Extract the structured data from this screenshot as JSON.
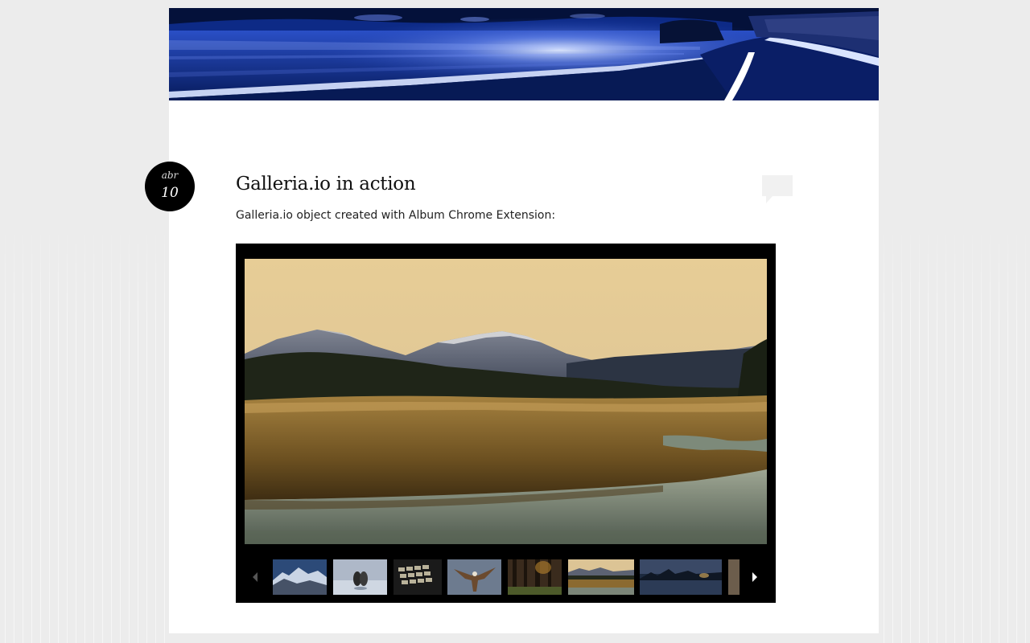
{
  "post": {
    "date": {
      "month": "abr",
      "day": "10"
    },
    "title": "Galleria.io in action",
    "text": "Galleria.io object created with Album Chrome Extension:"
  },
  "header": {
    "banner": "night coastal road"
  },
  "icons": {
    "comments": "speech-bubble-icon",
    "prev": "triangle-left-icon",
    "next": "triangle-right-icon"
  },
  "gallery": {
    "main_image": "mountain valley at golden hour with river reflection",
    "thumbnails": [
      {
        "name": "snowy-mountain-range"
      },
      {
        "name": "birds-on-ice"
      },
      {
        "name": "keyboard-closeup"
      },
      {
        "name": "eagle-in-flight"
      },
      {
        "name": "forest-trees"
      },
      {
        "name": "valley-river-sunset",
        "active": true
      },
      {
        "name": "lake-at-dusk"
      },
      {
        "name": "partial-thumbnail"
      }
    ]
  },
  "colors": {
    "page_bg": "#ececec",
    "content_bg": "#ffffff",
    "gallery_bg": "#000000",
    "badge_bg": "#000000",
    "comment_icon": "#f1f1f1"
  }
}
